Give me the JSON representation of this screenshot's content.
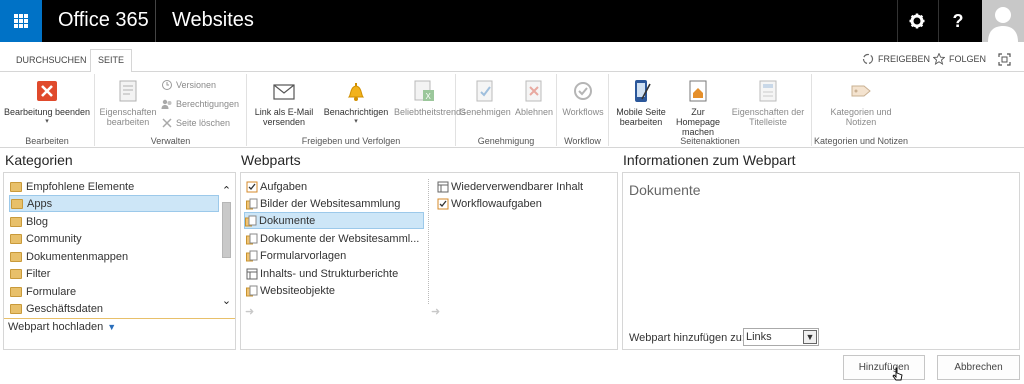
{
  "suitebar": {
    "brand": "Office 365",
    "site": "Websites",
    "settings_icon": "gear-icon",
    "help_label": "?"
  },
  "tabs": [
    {
      "label": "DURCHSUCHEN",
      "active": false
    },
    {
      "label": "SEITE",
      "active": true
    }
  ],
  "tab_actions": {
    "share": "FREIGEBEN",
    "follow": "FOLGEN"
  },
  "ribbon": {
    "groups": {
      "bearbeiten": "Bearbeiten",
      "verwalten": "Verwalten",
      "freigeben": "Freigeben und Verfolgen",
      "genehmigung": "Genehmigung",
      "workflow": "Workflow",
      "seitenaktionen": "Seitenaktionen",
      "kategorien": "Kategorien und Notizen"
    },
    "buttons": {
      "stop_editing": "Bearbeitung beenden",
      "edit_props_1": "Eigenschaften",
      "edit_props_2": "bearbeiten",
      "versions": "Versionen",
      "permissions": "Berechtigungen",
      "delete_page": "Seite löschen",
      "email_link_1": "Link als E-Mail",
      "email_link_2": "versenden",
      "notify": "Benachrichtigen",
      "popularity": "Beliebtheitstrends",
      "approve": "Genehmigen",
      "reject": "Ablehnen",
      "workflows": "Workflows",
      "mobile_1": "Mobile Seite",
      "mobile_2": "bearbeiten",
      "homepage_1": "Zur Homepage",
      "homepage_2": "machen",
      "titlebar_1": "Eigenschaften der",
      "titlebar_2": "Titelleiste",
      "tags_1": "Kategorien und",
      "tags_2": "Notizen"
    }
  },
  "categories": {
    "title": "Kategorien",
    "items": [
      {
        "label": "Empfohlene Elemente",
        "selected": false
      },
      {
        "label": "Apps",
        "selected": true
      },
      {
        "label": "Blog",
        "selected": false
      },
      {
        "label": "Community",
        "selected": false
      },
      {
        "label": "Dokumentenmappen",
        "selected": false
      },
      {
        "label": "Filter",
        "selected": false
      },
      {
        "label": "Formulare",
        "selected": false
      },
      {
        "label": "Geschäftsdaten",
        "selected": false
      }
    ],
    "upload": "Webpart hochladen"
  },
  "webparts": {
    "title": "Webparts",
    "col1": [
      {
        "label": "Aufgaben",
        "selected": false
      },
      {
        "label": "Bilder der Websitesammlung",
        "selected": false
      },
      {
        "label": "Dokumente",
        "selected": true
      },
      {
        "label": "Dokumente der Websitesamml...",
        "selected": false
      },
      {
        "label": "Formularvorlagen",
        "selected": false
      },
      {
        "label": "Inhalts- und Strukturberichte",
        "selected": false
      },
      {
        "label": "Websiteobjekte",
        "selected": false
      }
    ],
    "col2": [
      {
        "label": "Wiederverwendbarer Inhalt",
        "selected": false
      },
      {
        "label": "Workflowaufgaben",
        "selected": false
      }
    ]
  },
  "info": {
    "title": "Informationen zum Webpart",
    "webpart_name": "Dokumente",
    "add_to_label": "Webpart hinzufügen zu:",
    "add_to_value": "Links"
  },
  "actions": {
    "add": "Hinzufügen",
    "cancel": "Abbrechen"
  }
}
